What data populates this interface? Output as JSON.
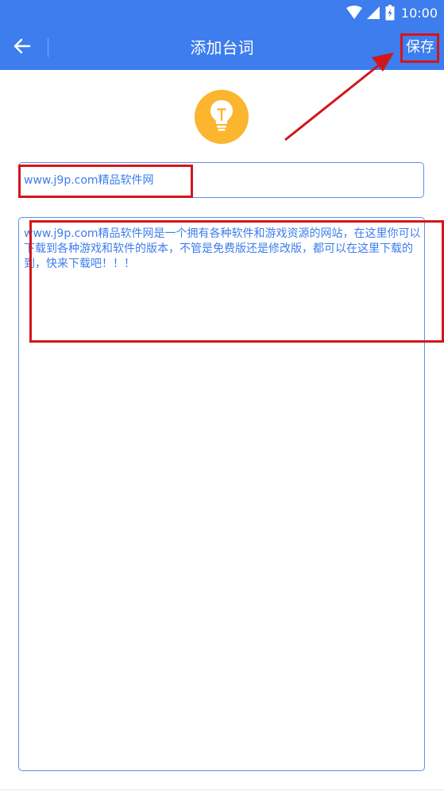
{
  "status_bar": {
    "time": "10:00",
    "icons": [
      "wifi-icon",
      "signal-icon",
      "battery-icon"
    ]
  },
  "app_bar": {
    "title": "添加台词",
    "back_icon": "back-arrow-icon",
    "save_label": "保存"
  },
  "header_icon": "lightbulb-icon",
  "form": {
    "title_value": "www.j9p.com精品软件网",
    "content_value": "www.j9p.com精品软件网是一个拥有各种软件和游戏资源的网站，在这里你可以下载到各种游戏和软件的版本，不管是免费版还是修改版，都可以在这里下载的到，快来下载吧！！！"
  },
  "colors": {
    "primary": "#3d7ded",
    "bulb": "#fbb52e",
    "annotation": "#d3161b"
  }
}
